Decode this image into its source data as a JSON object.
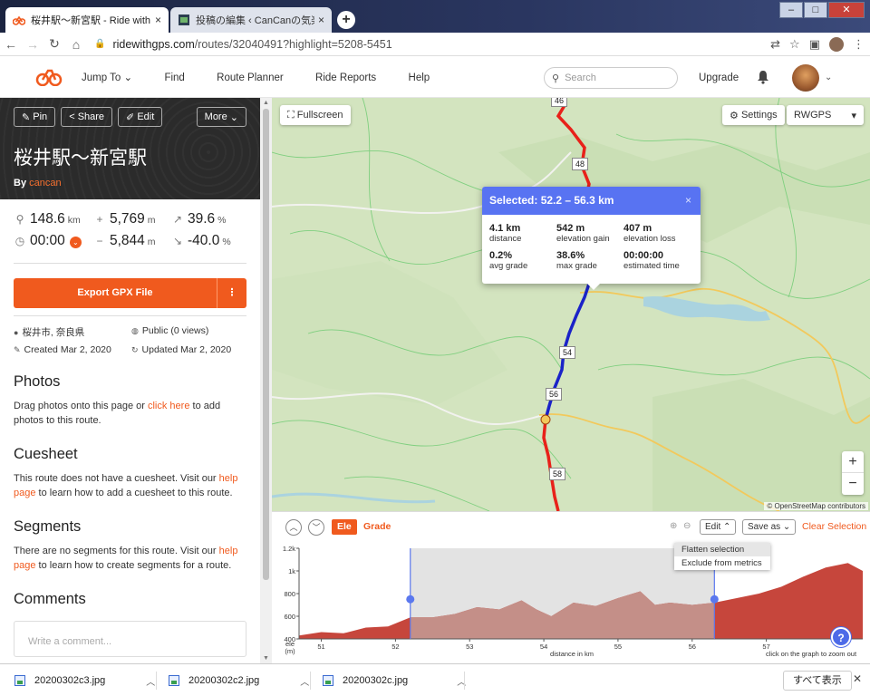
{
  "browser": {
    "tabs": [
      {
        "title": "桜井駅～新宮駅 - Ride with GPS",
        "close": "×"
      },
      {
        "title": "投稿の編集 ‹ CanCanの気楽な〜",
        "close": "×"
      }
    ],
    "new_tab": "+",
    "window": {
      "minimize": "–",
      "maximize": "□",
      "close": "✕"
    },
    "url_host": "ridewithgps.com",
    "url_path": "/routes/32040491?highlight=5208-5451"
  },
  "header": {
    "menu": [
      "Jump To",
      "Find",
      "Route Planner",
      "Ride Reports",
      "Help"
    ],
    "search_placeholder": "Search",
    "upgrade": "Upgrade"
  },
  "route": {
    "buttons": {
      "pin": "Pin",
      "share": "Share",
      "edit": "Edit",
      "more": "More"
    },
    "title": "桜井駅～新宮駅",
    "by_label": "By",
    "author": "cancan",
    "stats": {
      "distance": {
        "value": "148.6",
        "unit": "km"
      },
      "elev_gain": {
        "value": "5,769",
        "unit": "m"
      },
      "max_grade": {
        "value": "39.6",
        "unit": "%"
      },
      "time": {
        "value": "00:00"
      },
      "elev_loss": {
        "value": "5,844",
        "unit": "m"
      },
      "min_grade": {
        "value": "-40.0",
        "unit": "%"
      }
    },
    "export_label": "Export GPX File",
    "meta": {
      "location": "桜井市, 奈良県",
      "visibility": "Public (0 views)",
      "created": "Created Mar 2, 2020",
      "updated": "Updated Mar 2, 2020"
    }
  },
  "sections": {
    "photos": {
      "title": "Photos",
      "pre": "Drag photos onto this page or ",
      "link": "click here",
      "post": " to add photos to this route."
    },
    "cuesheet": {
      "title": "Cuesheet",
      "pre": "This route does not have a cuesheet. Visit our ",
      "link": "help page",
      "post": " to learn how to add a cuesheet to this route."
    },
    "segments": {
      "title": "Segments",
      "pre": "There are no segments for this route. Visit our ",
      "link": "help page",
      "post": " to learn how to create segments for a route."
    },
    "comments": {
      "title": "Comments",
      "placeholder": "Write a comment..."
    }
  },
  "map": {
    "fullscreen": "Fullscreen",
    "settings": "Settings",
    "layer": "RWGPS",
    "zoom_in": "+",
    "zoom_out": "−",
    "attribution": "© OpenStreetMap contributors",
    "km_markers": [
      "46",
      "48",
      "54",
      "56",
      "58"
    ],
    "popup": {
      "title": "Selected: 52.2 – 56.3 km",
      "close": "×",
      "cells": [
        {
          "value": "4.1 km",
          "label": "distance"
        },
        {
          "value": "542 m",
          "label": "elevation gain"
        },
        {
          "value": "407 m",
          "label": "elevation loss"
        },
        {
          "value": "0.2%",
          "label": "avg grade"
        },
        {
          "value": "38.6%",
          "label": "max grade"
        },
        {
          "value": "00:00:00",
          "label": "estimated time"
        }
      ]
    },
    "colors": {
      "route": "#e8211a",
      "selection": "#1a22c8",
      "water": "#aad3df"
    }
  },
  "elevation": {
    "tab_ele": "Ele",
    "tab_grade": "Grade",
    "edit": "Edit",
    "save_as": "Save as",
    "clear_selection": "Clear Selection",
    "dropdown": [
      "Flatten selection",
      "Exclude from metrics"
    ],
    "y_unit_label": [
      "ele",
      "(m)"
    ],
    "x_label": "distance in km",
    "zoom_hint": "click on the graph to zoom out",
    "help": "?",
    "chart_data": {
      "type": "area",
      "x": [
        50.7,
        51.0,
        51.3,
        51.6,
        51.9,
        52.2,
        52.5,
        52.8,
        53.1,
        53.4,
        53.7,
        53.9,
        54.1,
        54.4,
        54.7,
        55.0,
        55.3,
        55.5,
        55.7,
        56.0,
        56.3,
        56.6,
        56.9,
        57.2,
        57.5,
        57.8,
        58.1,
        58.3
      ],
      "y": [
        430,
        460,
        450,
        500,
        510,
        590,
        590,
        620,
        680,
        660,
        740,
        660,
        600,
        720,
        690,
        760,
        820,
        700,
        720,
        700,
        720,
        760,
        800,
        860,
        950,
        1030,
        1070,
        1000
      ],
      "selection": [
        52.2,
        56.3
      ],
      "xlim": [
        50.7,
        58.3
      ],
      "ylim": [
        400,
        1200
      ],
      "x_ticks": [
        51,
        52,
        53,
        54,
        55,
        56,
        57
      ],
      "y_ticks": [
        {
          "v": 400,
          "label": "400"
        },
        {
          "v": 600,
          "label": "600"
        },
        {
          "v": 800,
          "label": "800"
        },
        {
          "v": 1000,
          "label": "1k"
        },
        {
          "v": 1200,
          "label": "1.2k"
        }
      ],
      "colors": {
        "fill": "#c6463c",
        "selection_bg": "#e3e3e3",
        "selection_fill": "#c48f88",
        "marker": "#5b78ee"
      }
    }
  },
  "downloads": {
    "files": [
      "20200302c3.jpg",
      "20200302c2.jpg",
      "20200302c.jpg"
    ],
    "show_all": "すべて表示",
    "close": "✕"
  }
}
